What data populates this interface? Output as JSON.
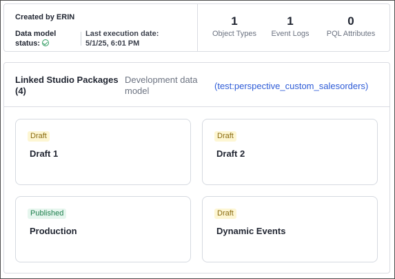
{
  "summary": {
    "created_by": "Created by ERIN",
    "data_model_status_label": "Data model status:",
    "data_model_status_icon": "check-circle-icon",
    "last_execution_label": "Last execution date:",
    "last_execution_value": "5/1/25, 6:01 PM",
    "stats": [
      {
        "value": "1",
        "label": "Object Types"
      },
      {
        "value": "1",
        "label": "Event Logs"
      },
      {
        "value": "0",
        "label": "PQL Attributes"
      }
    ]
  },
  "packages": {
    "title": "Linked Studio Packages (4)",
    "subtitle": "Development data model",
    "link": "(test:perspective_custom_salesorders)",
    "cards": [
      {
        "badge": "Draft",
        "name": "Draft 1"
      },
      {
        "badge": "Draft",
        "name": "Draft 2"
      },
      {
        "badge": "Published",
        "name": "Production"
      },
      {
        "badge": "Draft",
        "name": "Dynamic Events"
      }
    ]
  },
  "colors": {
    "link": "#2d5bd7",
    "draft_badge_bg": "#fdf6d3",
    "draft_badge_text": "#8a6b10",
    "published_badge_bg": "#e6f6ee",
    "published_badge_text": "#1e7f4d",
    "status_ok": "#2e9b5f"
  }
}
